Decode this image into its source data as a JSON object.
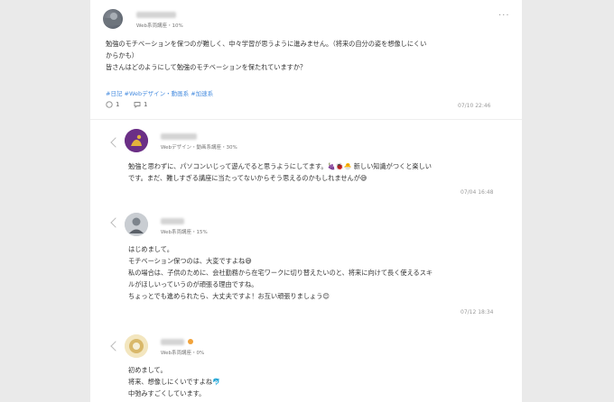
{
  "post": {
    "author_sub": "Web系両講座・10%",
    "body_lines": [
      "勉強のモチベーションを保つのが難しく、中々学習が思うように進みません。（将来の自分の姿を想像しにくい",
      "からかも）",
      "皆さんはどのようにして勉強のモチベーションを保たれていますか？"
    ],
    "tags": "#日記 #Webデザイン・動画系 #加速系",
    "like_count": "1",
    "comment_count": "1",
    "timestamp": "07/10 22:46"
  },
  "replies": [
    {
      "author_sub": "Webデザイン・動画系講座・30%",
      "body_lines": [
        "勉強と思わずに、パソコンいじって遊んでると思うようにしてます。🍇🐞🐣 新しい知識がつくと楽しい",
        "です。まだ、難しすぎる講座に当たってないからそう思えるのかもしれませんが😅"
      ],
      "timestamp": "07/04 16:48"
    },
    {
      "author_sub": "Web系両講座・15%",
      "body_lines": [
        "はじめまして。",
        "モチベーション保つのは、大変ですよね😅",
        "私の場合は、子供のために、会社勤務から在宅ワークに切り替えたいのと、将来に向けて長く使えるスキ",
        "ルがほしいっていうのが頑張る理由ですね。",
        "ちょっとでも進められたら、大丈夫ですよ！お互い頑張りましょう😊"
      ],
      "timestamp": "07/12 18:34"
    },
    {
      "author_sub": "Web系両講座・0%",
      "body_lines": [
        "初めまして。",
        "将来、想像しにくいですよね🐬",
        "中弛みすごくしています。"
      ],
      "timestamp": ""
    }
  ],
  "colors": {
    "tag_blue": "#4b8fe0",
    "card_bg": "#ffffff",
    "page_bg": "#eaeaea",
    "muted_text": "#9a9a9a"
  }
}
